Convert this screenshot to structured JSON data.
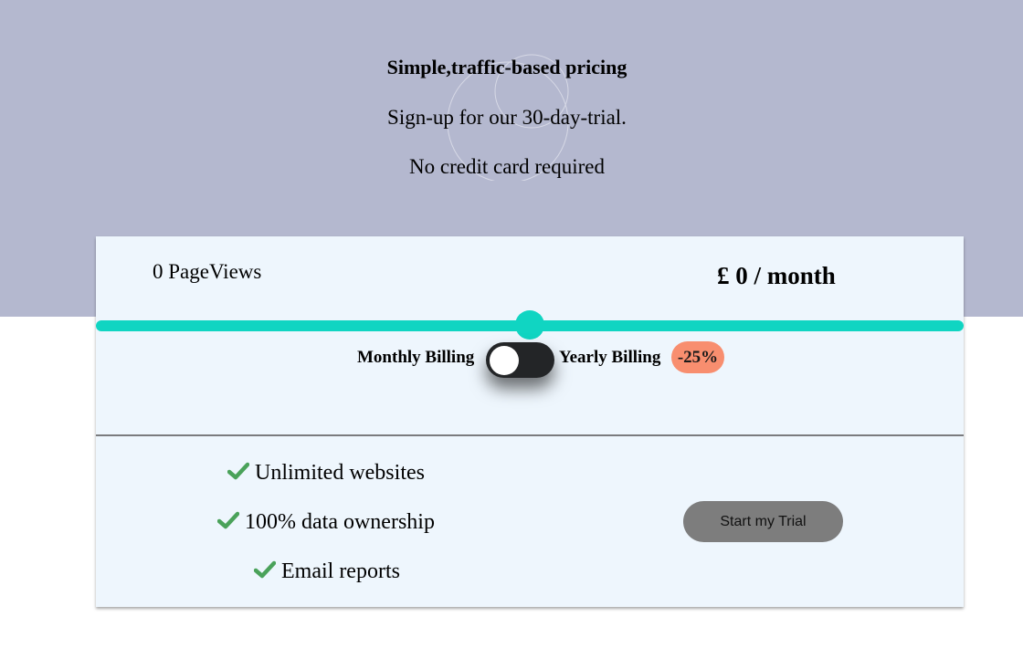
{
  "hero": {
    "title": "Simple,traffic-based pricing",
    "subtitle_line1": "Sign-up for our 30-day-trial.",
    "subtitle_line2": "No credit card required"
  },
  "pricing": {
    "pageviews_label": "0 PageViews",
    "price_label": "£ 0 / month",
    "slider_value_fraction": 0.5
  },
  "billing": {
    "monthly_label": "Monthly Billing",
    "yearly_label": "Yearly Billing",
    "discount_badge": "-25%",
    "toggle_state": "monthly"
  },
  "features": [
    {
      "icon": "check-icon",
      "label": "Unlimited websites"
    },
    {
      "icon": "check-icon",
      "label": "100% data ownership"
    },
    {
      "icon": "check-icon",
      "label": "Email reports"
    }
  ],
  "cta": {
    "trial_button_label": "Start my Trial"
  },
  "colors": {
    "hero_background": "#b4b8cf",
    "card_background": "#eef6fd",
    "slider_accent": "#10d5c2",
    "toggle_background": "#232527",
    "discount_badge": "#f88e6f",
    "check_green": "#4aa25a",
    "button_background": "#7d7d7d"
  }
}
